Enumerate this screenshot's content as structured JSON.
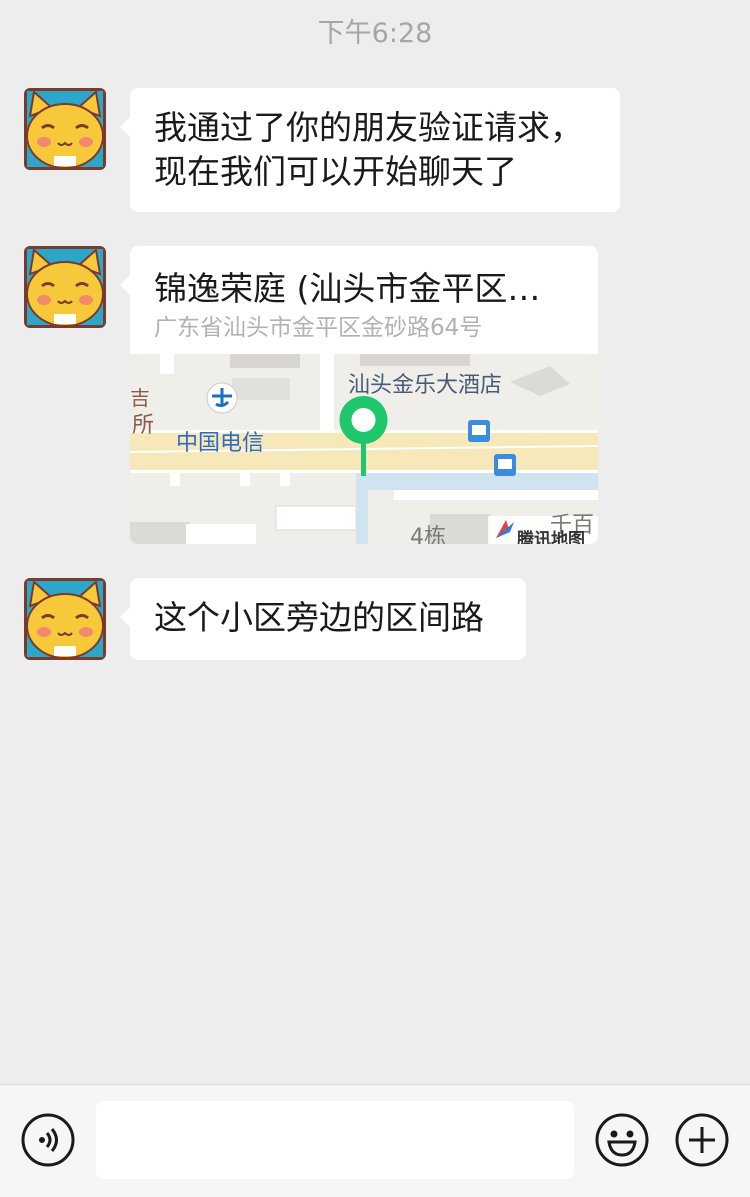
{
  "chat": {
    "timestamp": "下午6:28",
    "messages": [
      {
        "type": "text",
        "text_line1": "我通过了你的朋友验证请求，",
        "text_line2": "现在我们可以开始聊天了"
      },
      {
        "type": "location",
        "title": "锦逸荣庭 (汕头市金平区…",
        "address": "广东省汕头市金平区金砂路64号",
        "map": {
          "labels": {
            "hotel": "汕头金乐大酒店",
            "telecom": "中国电信",
            "building": "4栋",
            "partial_top": "吉",
            "partial_mid": "所",
            "partial_right": "千百"
          },
          "provider": "腾讯地图",
          "pin_color": "#1ec76c"
        }
      },
      {
        "type": "text",
        "text": "这个小区旁边的区间路"
      }
    ]
  },
  "input_bar": {
    "input_value": "",
    "voice_button": "voice-icon",
    "emoji_button": "emoji-icon",
    "more_button": "plus-icon"
  }
}
